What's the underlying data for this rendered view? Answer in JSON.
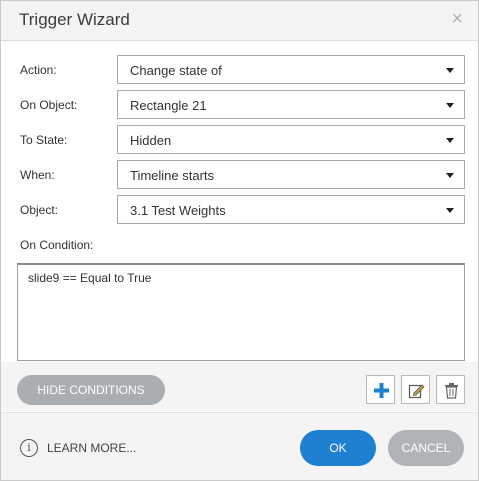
{
  "dialog": {
    "title": "Trigger Wizard",
    "close_icon": "close-icon"
  },
  "fields": [
    {
      "label": "Action:",
      "value": "Change state of"
    },
    {
      "label": "On Object:",
      "value": "Rectangle 21"
    },
    {
      "label": "To State:",
      "value": "Hidden"
    },
    {
      "label": "When:",
      "value": "Timeline starts"
    },
    {
      "label": "Object:",
      "value": "3.1 Test Weights"
    }
  ],
  "conditions": {
    "label": "On Condition:",
    "items": [
      "slide9 == Equal to True"
    ]
  },
  "toolbar": {
    "hide_conditions_label": "HIDE CONDITIONS",
    "add_icon": "plus-icon",
    "edit_icon": "edit-icon",
    "delete_icon": "trash-icon"
  },
  "footer": {
    "info_icon": "info-icon",
    "learn_more_label": "LEARN MORE...",
    "ok_label": "OK",
    "cancel_label": "CANCEL"
  },
  "colors": {
    "primary": "#1f7fd1",
    "secondary": "#b0b4b8",
    "add_icon": "#1f7fd1"
  }
}
